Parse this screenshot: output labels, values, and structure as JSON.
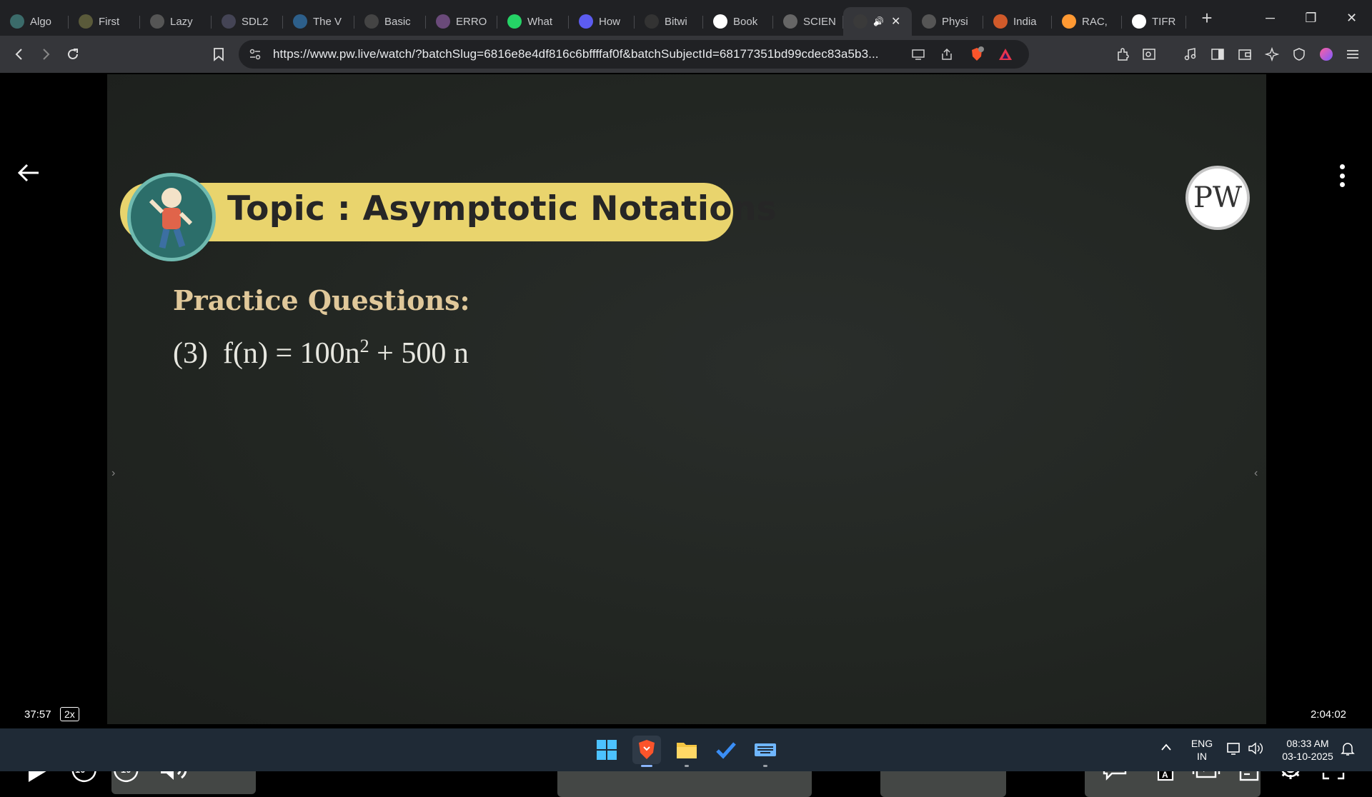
{
  "browser": {
    "tabs": [
      {
        "title": "Algo",
        "icon": "algo-favicon",
        "color": "#3b6b6a"
      },
      {
        "title": "First",
        "icon": "dollar-favicon",
        "color": "#5a5a3a"
      },
      {
        "title": "Lazy",
        "icon": "globe-favicon",
        "color": "#555"
      },
      {
        "title": "SDL2",
        "icon": "sdl-favicon",
        "color": "#445"
      },
      {
        "title": "The V",
        "icon": "wordpress-favicon",
        "color": "#2d5f8a"
      },
      {
        "title": "Basic",
        "icon": "gfg-favicon",
        "color": "#444"
      },
      {
        "title": "ERRO",
        "icon": "spiral-favicon",
        "color": "#6a4a7a"
      },
      {
        "title": "What",
        "icon": "whatsapp-favicon",
        "color": "#25d366"
      },
      {
        "title": "How",
        "icon": "feather-favicon",
        "color": "#5c5cf0"
      },
      {
        "title": "Bitwi",
        "icon": "oreilly-favicon",
        "color": "#333"
      },
      {
        "title": "Book",
        "icon": "google-favicon",
        "color": "#ffffff"
      },
      {
        "title": "SCIEN",
        "icon": "globe-favicon",
        "color": "#666"
      },
      {
        "title": "",
        "icon": "pw-favicon",
        "color": "#3a3a3a",
        "active": true
      },
      {
        "title": "Physi",
        "icon": "physics-favicon",
        "color": "#555"
      },
      {
        "title": "India",
        "icon": "india-favicon",
        "color": "#d05a2a"
      },
      {
        "title": "RAC,",
        "icon": "flag-favicon",
        "color": "#ff9933"
      },
      {
        "title": "TIFR",
        "icon": "google-favicon",
        "color": "#ffffff"
      }
    ],
    "url": "https://www.pw.live/watch/?batchSlug=6816e8e4df816c6bffffaf0f&batchSubjectId=68177351bd99cdec83a5b3...",
    "brave_badge": "1"
  },
  "lecture": {
    "topic": "Topic : Asymptotic Notations",
    "heading": "Practice Questions:",
    "question_number": "(3)",
    "formula_lhs": "f(n) = 100n",
    "formula_exp": "2",
    "formula_rhs": " + 500 n",
    "logo": "PW"
  },
  "player": {
    "current_time": "37:57",
    "speed": "2x",
    "total_time": "2:04:02",
    "progress_fraction": 0.306,
    "rewind_label": "10",
    "forward_label": "10",
    "accent": "#5a5cf5"
  },
  "taskbar": {
    "language": "ENG",
    "region": "IN",
    "time": "08:33 AM",
    "date": "03-10-2025"
  }
}
